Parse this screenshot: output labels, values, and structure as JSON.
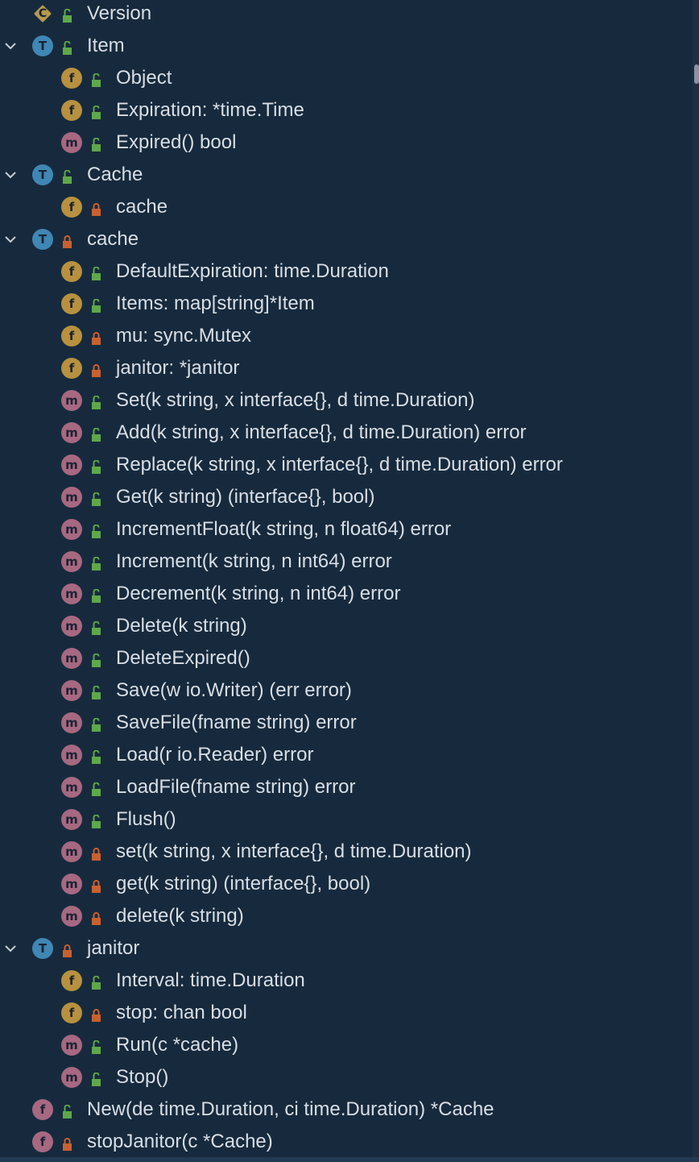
{
  "tree": {
    "items": [
      {
        "depth": 1,
        "kind": "C",
        "vis": "public",
        "label": "Version",
        "expandable": false
      },
      {
        "depth": 1,
        "kind": "T",
        "vis": "public",
        "label": "Item",
        "expandable": true
      },
      {
        "depth": 2,
        "kind": "f",
        "vis": "public",
        "label": "Object",
        "expandable": false
      },
      {
        "depth": 2,
        "kind": "f",
        "vis": "public",
        "label": "Expiration: *time.Time",
        "expandable": false
      },
      {
        "depth": 2,
        "kind": "m",
        "vis": "public",
        "label": "Expired() bool",
        "expandable": false
      },
      {
        "depth": 1,
        "kind": "T",
        "vis": "public",
        "label": "Cache",
        "expandable": true
      },
      {
        "depth": 2,
        "kind": "f",
        "vis": "private",
        "label": "cache",
        "expandable": false
      },
      {
        "depth": 1,
        "kind": "T",
        "vis": "private",
        "label": "cache",
        "expandable": true
      },
      {
        "depth": 2,
        "kind": "f",
        "vis": "public",
        "label": "DefaultExpiration: time.Duration",
        "expandable": false
      },
      {
        "depth": 2,
        "kind": "f",
        "vis": "public",
        "label": "Items: map[string]*Item",
        "expandable": false
      },
      {
        "depth": 2,
        "kind": "f",
        "vis": "private",
        "label": "mu: sync.Mutex",
        "expandable": false
      },
      {
        "depth": 2,
        "kind": "f",
        "vis": "private",
        "label": "janitor: *janitor",
        "expandable": false
      },
      {
        "depth": 2,
        "kind": "m",
        "vis": "public",
        "label": "Set(k string, x interface{}, d time.Duration)",
        "expandable": false
      },
      {
        "depth": 2,
        "kind": "m",
        "vis": "public",
        "label": "Add(k string, x interface{}, d time.Duration) error",
        "expandable": false
      },
      {
        "depth": 2,
        "kind": "m",
        "vis": "public",
        "label": "Replace(k string, x interface{}, d time.Duration) error",
        "expandable": false
      },
      {
        "depth": 2,
        "kind": "m",
        "vis": "public",
        "label": "Get(k string) (interface{}, bool)",
        "expandable": false
      },
      {
        "depth": 2,
        "kind": "m",
        "vis": "public",
        "label": "IncrementFloat(k string, n float64) error",
        "expandable": false
      },
      {
        "depth": 2,
        "kind": "m",
        "vis": "public",
        "label": "Increment(k string, n int64) error",
        "expandable": false
      },
      {
        "depth": 2,
        "kind": "m",
        "vis": "public",
        "label": "Decrement(k string, n int64) error",
        "expandable": false
      },
      {
        "depth": 2,
        "kind": "m",
        "vis": "public",
        "label": "Delete(k string)",
        "expandable": false
      },
      {
        "depth": 2,
        "kind": "m",
        "vis": "public",
        "label": "DeleteExpired()",
        "expandable": false
      },
      {
        "depth": 2,
        "kind": "m",
        "vis": "public",
        "label": "Save(w io.Writer) (err error)",
        "expandable": false
      },
      {
        "depth": 2,
        "kind": "m",
        "vis": "public",
        "label": "SaveFile(fname string) error",
        "expandable": false
      },
      {
        "depth": 2,
        "kind": "m",
        "vis": "public",
        "label": "Load(r io.Reader) error",
        "expandable": false
      },
      {
        "depth": 2,
        "kind": "m",
        "vis": "public",
        "label": "LoadFile(fname string) error",
        "expandable": false
      },
      {
        "depth": 2,
        "kind": "m",
        "vis": "public",
        "label": "Flush()",
        "expandable": false
      },
      {
        "depth": 2,
        "kind": "m",
        "vis": "private",
        "label": "set(k string, x interface{}, d time.Duration)",
        "expandable": false
      },
      {
        "depth": 2,
        "kind": "m",
        "vis": "private",
        "label": "get(k string) (interface{}, bool)",
        "expandable": false
      },
      {
        "depth": 2,
        "kind": "m",
        "vis": "private",
        "label": "delete(k string)",
        "expandable": false
      },
      {
        "depth": 1,
        "kind": "T",
        "vis": "private",
        "label": "janitor",
        "expandable": true
      },
      {
        "depth": 2,
        "kind": "f",
        "vis": "public",
        "label": "Interval: time.Duration",
        "expandable": false
      },
      {
        "depth": 2,
        "kind": "f",
        "vis": "private",
        "label": "stop: chan bool",
        "expandable": false
      },
      {
        "depth": 2,
        "kind": "m",
        "vis": "public",
        "label": "Run(c *cache)",
        "expandable": false
      },
      {
        "depth": 2,
        "kind": "m",
        "vis": "public",
        "label": "Stop()",
        "expandable": false
      },
      {
        "depth": 1,
        "kind": "F",
        "vis": "public",
        "label": "New(de time.Duration, ci time.Duration) *Cache",
        "expandable": false
      },
      {
        "depth": 1,
        "kind": "F",
        "vis": "private",
        "label": "stopJanitor(c *Cache)",
        "expandable": false
      }
    ]
  },
  "icons": {
    "C": {
      "letter": "C",
      "name": "constant-icon"
    },
    "T": {
      "letter": "T",
      "name": "type-icon"
    },
    "f": {
      "letter": "f",
      "name": "field-icon"
    },
    "m": {
      "letter": "m",
      "name": "method-icon"
    },
    "F": {
      "letter": "f",
      "name": "function-icon"
    }
  },
  "colors": {
    "background": "#172a3d",
    "text": "#d8dee6",
    "type": "#3f87b5",
    "field": "#b7913f",
    "method": "#a76881",
    "public_lock": "#5fa84a",
    "private_lock": "#c9612f",
    "chevron": "#c6ccd3"
  }
}
